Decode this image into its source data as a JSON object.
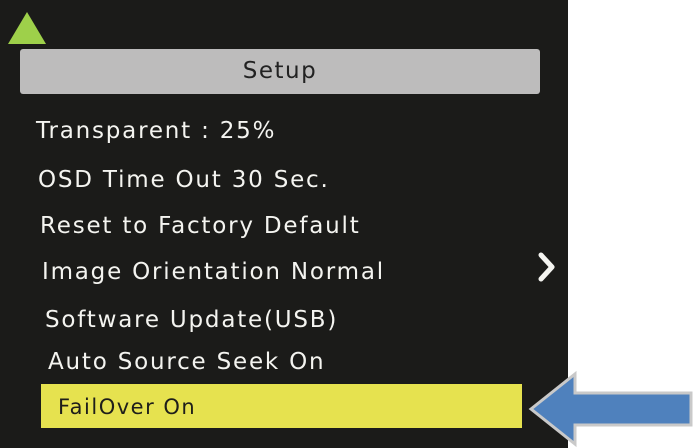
{
  "screen": {
    "title": "Setup",
    "scroll_indicator": "triangle-up-icon",
    "items": [
      "Transparent :  25%",
      "OSD Time Out  30 Sec.",
      "Reset to Factory Default",
      "Image Orientation  Normal",
      "Software Update(USB)",
      "Auto Source Seek  On"
    ],
    "selected_item": "FailOver  On",
    "submenu_indicator": "chevron-right-icon"
  },
  "annotation": {
    "arrow": "arrow-left-icon"
  },
  "colors": {
    "background": "#1b1b19",
    "title_bar": "#bdbcbc",
    "highlight": "#e6e24f",
    "up_triangle": "#9ed04a",
    "annotation_arrow": "#4f81bd"
  }
}
